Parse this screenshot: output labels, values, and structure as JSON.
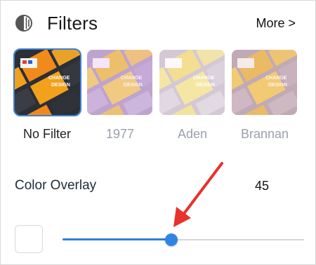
{
  "header": {
    "title": "Filters",
    "more_label": "More >",
    "icon": "half-circle-filter-icon"
  },
  "filters": [
    {
      "label": "No Filter",
      "selected": true,
      "tone": "original"
    },
    {
      "label": "1977",
      "selected": false,
      "tone": "pink-violet"
    },
    {
      "label": "Aden",
      "selected": false,
      "tone": "washed-pastel"
    },
    {
      "label": "Brannan",
      "selected": false,
      "tone": "warm-contrast"
    }
  ],
  "overlay": {
    "label": "Color Overlay",
    "value": "45",
    "level_fraction": 0.45
  },
  "colors": {
    "accent": "#2f86e2",
    "selected_outline": "#3f7fd0",
    "annotation_arrow": "#e8322b",
    "muted_text": "#9aa0aa"
  }
}
